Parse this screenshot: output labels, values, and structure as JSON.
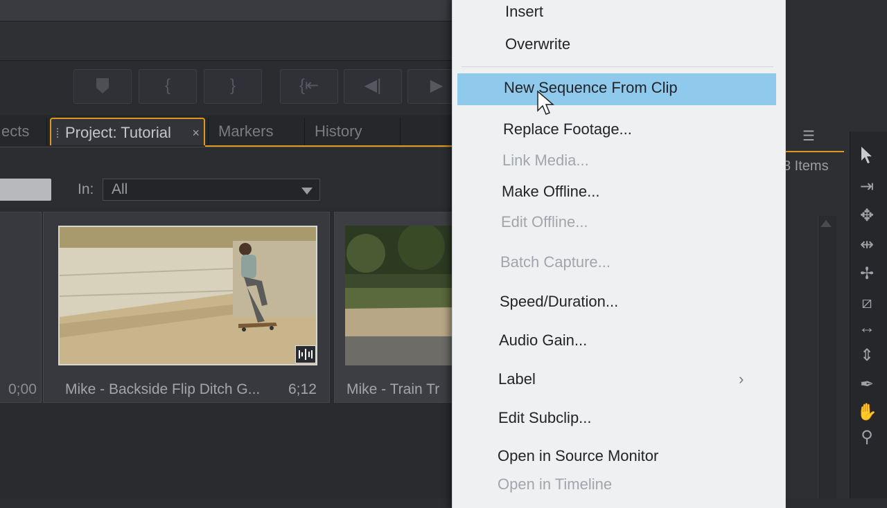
{
  "tabs": {
    "effects": "ects",
    "project": "Project: Tutorial",
    "project_close": "×",
    "markers": "Markers",
    "history": "History"
  },
  "filter": {
    "in_label": "In:",
    "in_value": "All"
  },
  "clips": [
    {
      "name": "Mike - Backside Flip Ditch G...",
      "duration": "6;12"
    },
    {
      "name": "Mike - Train Tr",
      "duration": ""
    }
  ],
  "left_card_duration": "0;00",
  "project_panel": {
    "items_count": "3 Items"
  },
  "context_menu": {
    "items": [
      {
        "label": "Insert",
        "enabled": true
      },
      {
        "label": "Overwrite",
        "enabled": true
      },
      {
        "label": "New Sequence From Clip",
        "enabled": true,
        "highlighted": true
      },
      {
        "label": "Replace Footage...",
        "enabled": true
      },
      {
        "label": "Link Media...",
        "enabled": false
      },
      {
        "label": "Make Offline...",
        "enabled": true
      },
      {
        "label": "Edit Offline...",
        "enabled": false
      },
      {
        "label": "Batch Capture...",
        "enabled": false
      },
      {
        "label": "Speed/Duration...",
        "enabled": true
      },
      {
        "label": "Audio Gain...",
        "enabled": true
      },
      {
        "label": "Label",
        "enabled": true,
        "submenu": true
      },
      {
        "label": "Edit Subclip...",
        "enabled": true
      },
      {
        "label": "Open in Source Monitor",
        "enabled": true
      },
      {
        "label": "Open in Timeline",
        "enabled": false
      }
    ],
    "submenu_arrow": "›"
  },
  "colors": {
    "accent": "#e09a1a",
    "menu_highlight": "#8fc9ec",
    "menu_bg": "#eef0f2",
    "panel_bg": "#2c2d31"
  }
}
